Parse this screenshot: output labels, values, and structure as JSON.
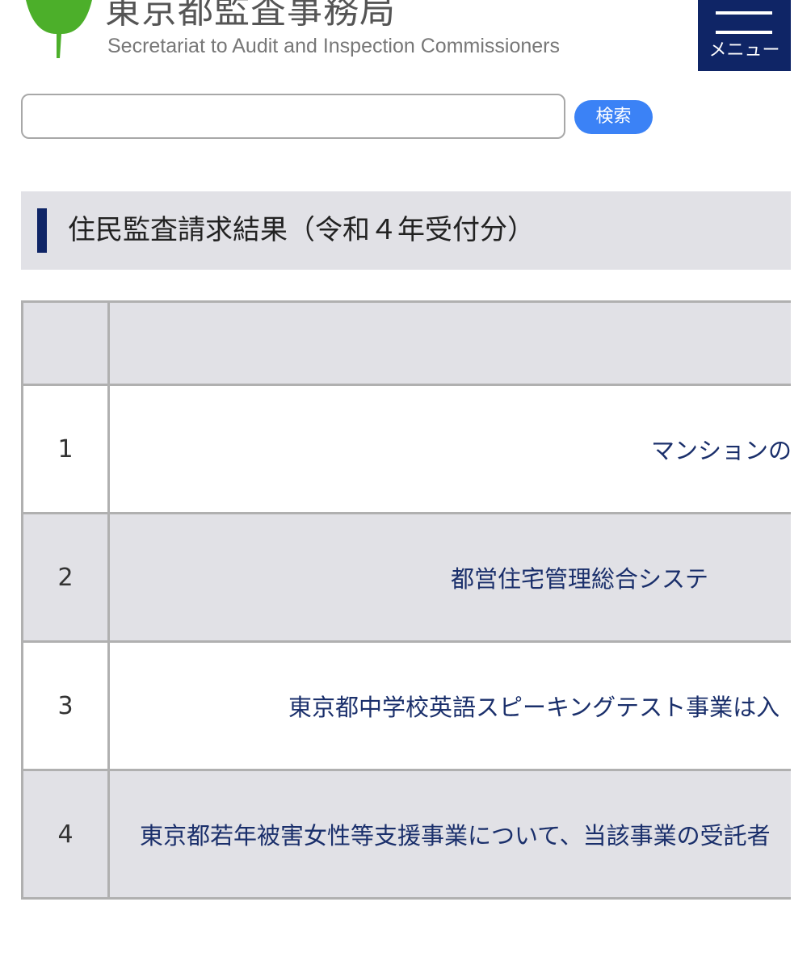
{
  "header": {
    "title": "東京都監査事務局",
    "subtitle": "Secretariat to Audit and Inspection Commissioners",
    "menu_label": "メニュー",
    "logo_icon": "ginkgo-leaf-icon",
    "brand_color": "#0f2566",
    "logo_color": "#4caf2a"
  },
  "search": {
    "value": "",
    "button_label": "検索",
    "button_color": "#3b82f6"
  },
  "page": {
    "heading": "住民監査請求結果（令和４年受付分）"
  },
  "table": {
    "header_cells": [
      "",
      ""
    ],
    "rows": [
      {
        "number": "1",
        "title": "マンションの"
      },
      {
        "number": "2",
        "title": "都営住宅管理総合システ"
      },
      {
        "number": "3",
        "title": "東京都中学校英語スピーキングテスト事業は入"
      },
      {
        "number": "4",
        "title": "東京都若年被害女性等支援事業について、当該事業の受託者"
      }
    ]
  }
}
